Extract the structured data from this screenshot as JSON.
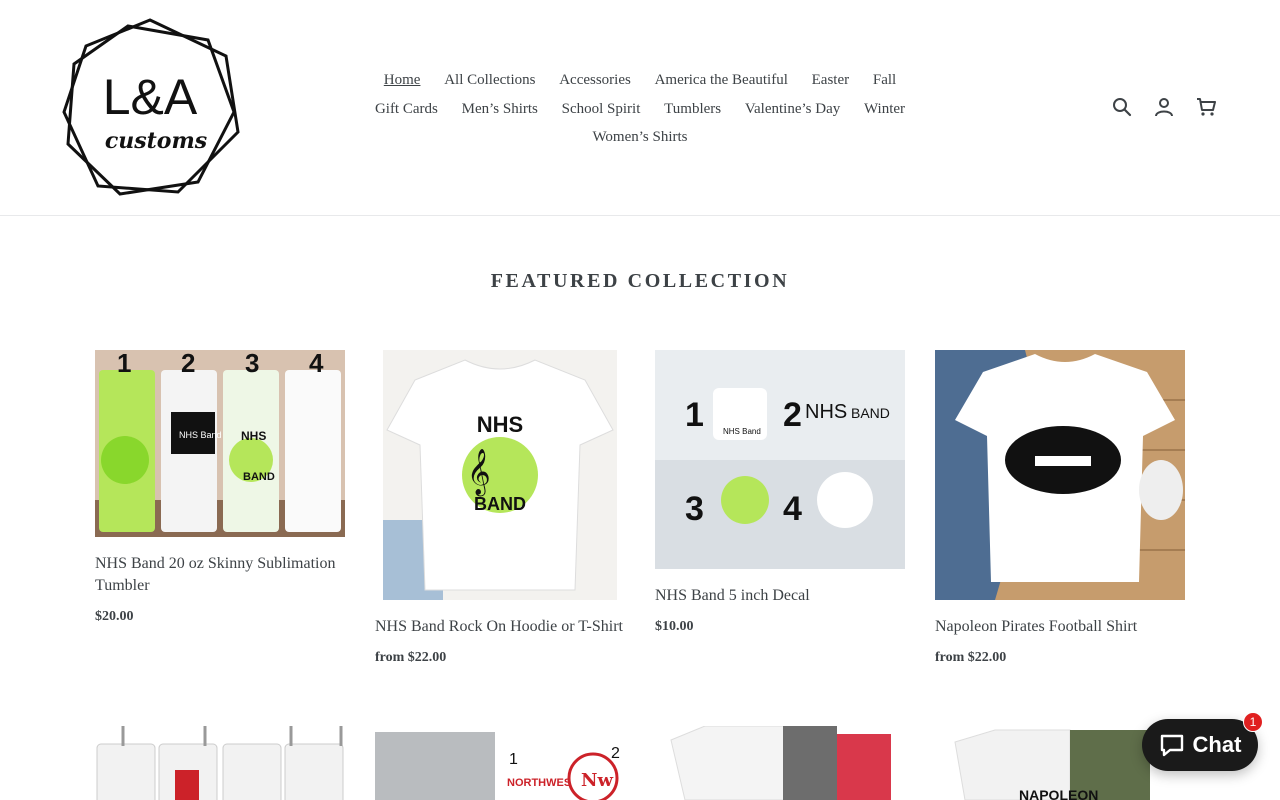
{
  "brand": {
    "logo_text_top": "L&A",
    "logo_text_bottom": "customs"
  },
  "nav": {
    "items": [
      {
        "label": "Home",
        "active": true
      },
      {
        "label": "All Collections"
      },
      {
        "label": "Accessories"
      },
      {
        "label": "America the Beautiful"
      },
      {
        "label": "Easter"
      },
      {
        "label": "Fall"
      },
      {
        "label": "Gift Cards"
      },
      {
        "label": "Men’s Shirts"
      },
      {
        "label": "School Spirit"
      },
      {
        "label": "Tumblers"
      },
      {
        "label": "Valentine’s Day"
      },
      {
        "label": "Winter"
      },
      {
        "label": "Women’s Shirts"
      }
    ]
  },
  "header_icons": [
    "search-icon",
    "account-icon",
    "cart-icon"
  ],
  "section": {
    "title": "FEATURED COLLECTION"
  },
  "products": [
    {
      "title": "NHS Band 20 oz Skinny Sublimation Tumbler",
      "price": "$20.00"
    },
    {
      "title": "NHS Band Rock On Hoodie or T-Shirt",
      "price": "from $22.00"
    },
    {
      "title": "NHS Band 5 inch Decal",
      "price": "$10.00"
    },
    {
      "title": "Napoleon Pirates Football Shirt",
      "price": "from $22.00"
    }
  ],
  "row2_image_text": {
    "northwest": "NORTHWEST",
    "nw": "Nw",
    "napoleon": "NAPOLEON"
  },
  "row1_image_text": {
    "nums": [
      "1",
      "2",
      "3",
      "4"
    ],
    "nhs_band": "NHS Band",
    "nhs": "NHS",
    "band": "BAND"
  },
  "chat": {
    "label": "Chat",
    "badge": "1"
  },
  "colors": {
    "accent_green": "#7ed321",
    "chat_bg": "#1a1a1a",
    "badge_red": "#e02020"
  }
}
